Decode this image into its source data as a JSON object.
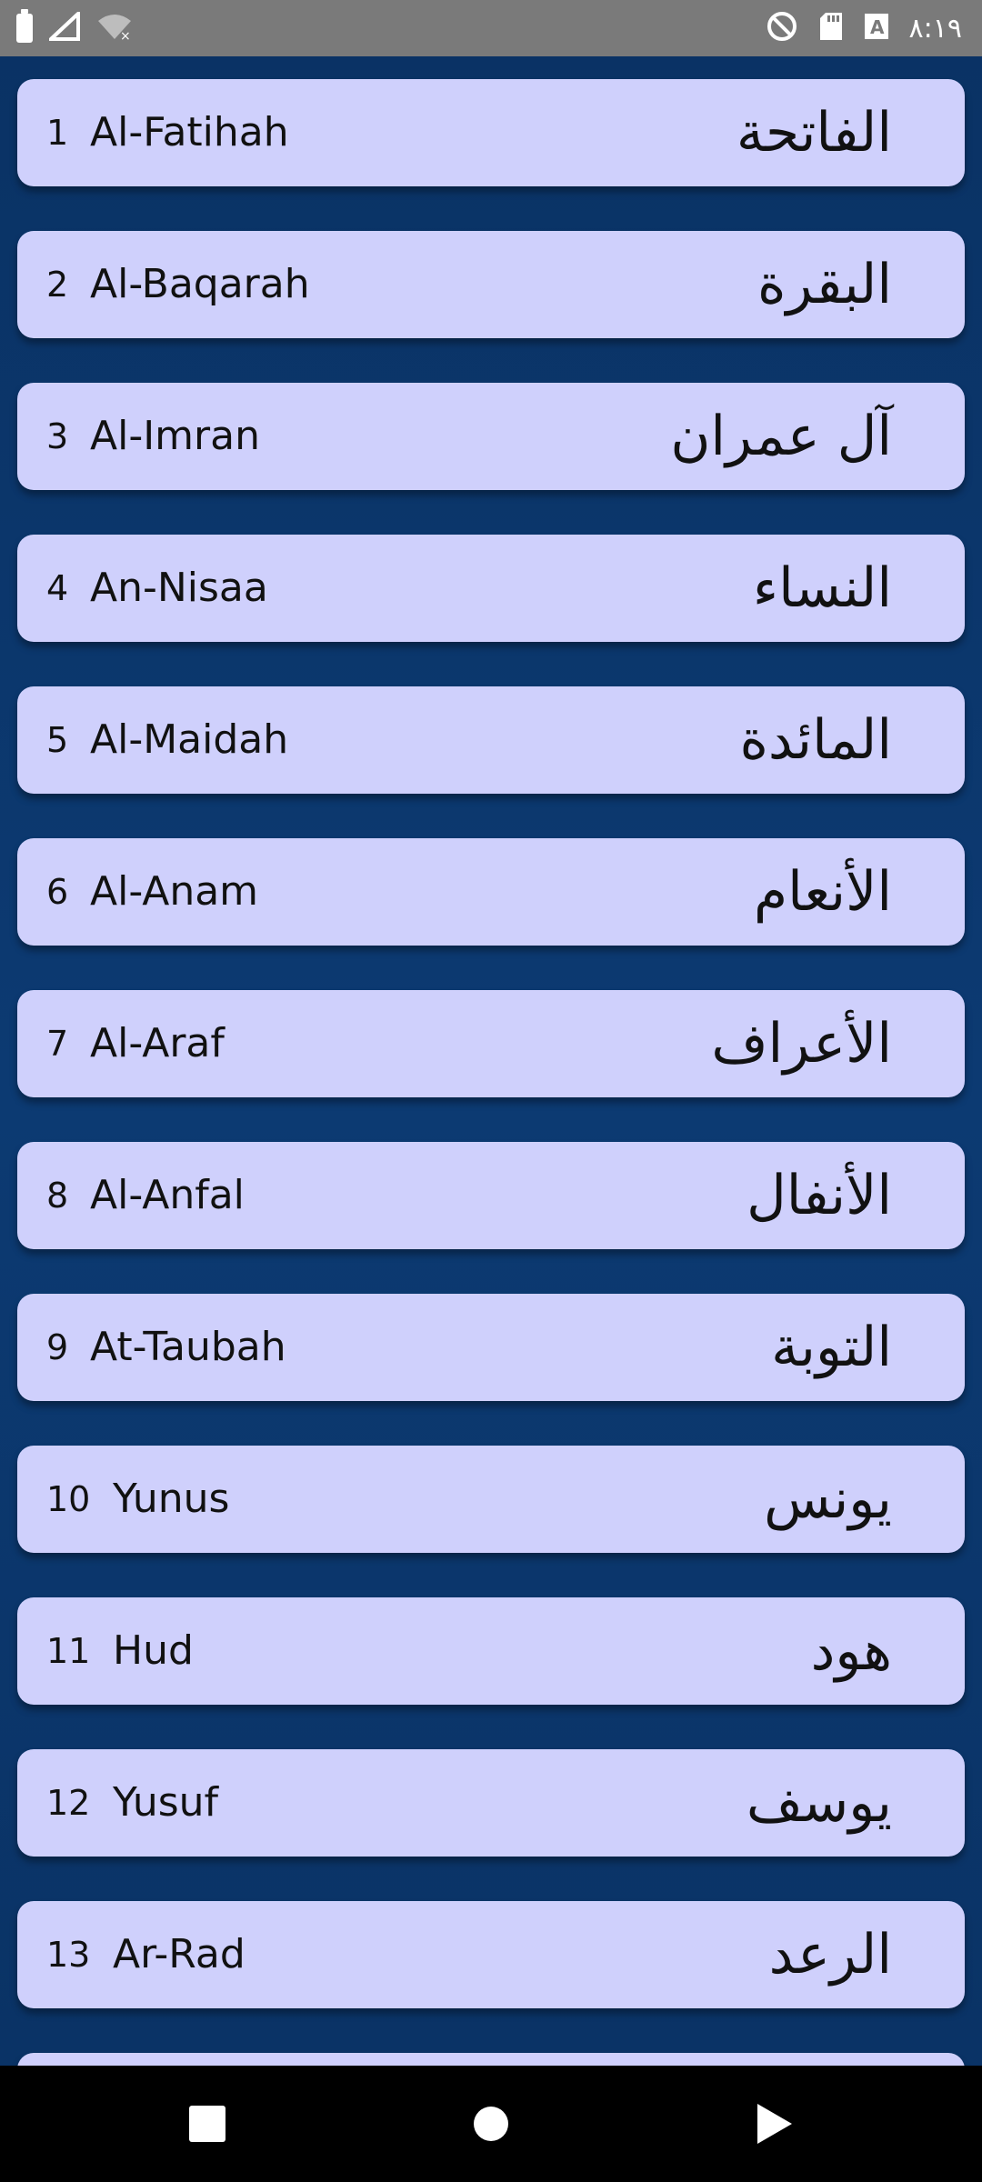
{
  "status_bar": {
    "time": "٨:١٩",
    "icons": [
      "battery-icon",
      "signal-icon",
      "wifi-off-icon",
      "sync-off-icon",
      "sd-card-icon",
      "a-icon"
    ],
    "a_label": "A"
  },
  "surahs": [
    {
      "number": "1",
      "name": "Al-Fatihah",
      "arabic": "الفاتحة"
    },
    {
      "number": "2",
      "name": "Al-Baqarah",
      "arabic": "البقرة"
    },
    {
      "number": "3",
      "name": "Al-Imran",
      "arabic": "آل عمران"
    },
    {
      "number": "4",
      "name": "An-Nisaa",
      "arabic": "النساء"
    },
    {
      "number": "5",
      "name": "Al-Maidah",
      "arabic": "المائدة"
    },
    {
      "number": "6",
      "name": "Al-Anam",
      "arabic": "الأنعام"
    },
    {
      "number": "7",
      "name": "Al-Araf",
      "arabic": "الأعراف"
    },
    {
      "number": "8",
      "name": "Al-Anfal",
      "arabic": "الأنفال"
    },
    {
      "number": "9",
      "name": "At-Taubah",
      "arabic": "التوبة"
    },
    {
      "number": "10",
      "name": "Yunus",
      "arabic": "يونس"
    },
    {
      "number": "11",
      "name": "Hud",
      "arabic": "هود"
    },
    {
      "number": "12",
      "name": "Yusuf",
      "arabic": "يوسف"
    },
    {
      "number": "13",
      "name": "Ar-Rad",
      "arabic": "الرعد"
    }
  ],
  "nav_bar": {
    "icons": [
      "recents-square-icon",
      "home-circle-icon",
      "back-triangle-icon"
    ]
  },
  "colors": {
    "background": "#0b3366",
    "card": "#cfd0fc",
    "status_bar": "#7a7a7a",
    "nav_bar": "#000000"
  }
}
